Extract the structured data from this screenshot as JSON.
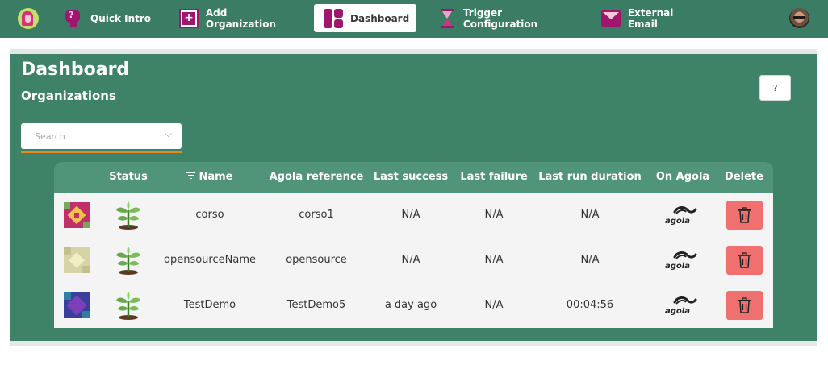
{
  "nav": {
    "items": [
      {
        "label": "Quick Intro",
        "icon": "quick-intro-icon"
      },
      {
        "label": "Add Organization",
        "icon": "add-organization-icon"
      },
      {
        "label": "Dashboard",
        "icon": "dashboard-icon",
        "active": true
      },
      {
        "label": "Trigger Configuration",
        "icon": "hourglass-icon"
      },
      {
        "label": "External Email",
        "icon": "email-icon"
      }
    ],
    "logo_icon": "app-logo",
    "avatar_icon": "user-avatar"
  },
  "page": {
    "title": "Dashboard",
    "section_title": "Organizations",
    "help_label": "?"
  },
  "search": {
    "placeholder": "Search",
    "value": ""
  },
  "table": {
    "headers": [
      "",
      "Status",
      "Name",
      "Agola reference",
      "Last success",
      "Last failure",
      "Last run duration",
      "On Agola",
      "Delete"
    ],
    "sort_icon": "sort-lines-icon",
    "rows": [
      {
        "name": "corso",
        "agola_reference": "corso1",
        "last_success": "N/A",
        "last_failure": "N/A",
        "last_run_duration": "N/A",
        "status_icon": "plant-icon",
        "on_agola": "agola"
      },
      {
        "name": "opensourceName",
        "agola_reference": "opensource",
        "last_success": "N/A",
        "last_failure": "N/A",
        "last_run_duration": "N/A",
        "status_icon": "plant-icon",
        "on_agola": "agola"
      },
      {
        "name": "TestDemo",
        "agola_reference": "TestDemo5",
        "last_success": "a day ago",
        "last_failure": "N/A",
        "last_run_duration": "00:04:56",
        "status_icon": "plant-icon",
        "on_agola": "agola"
      }
    ]
  },
  "colors": {
    "navbar": "#3a7d64",
    "panel": "#3e8268",
    "table_header": "#50957a",
    "accent_orange": "#e68a1f",
    "delete": "#f07070",
    "icon_magenta": "#a0166e"
  }
}
